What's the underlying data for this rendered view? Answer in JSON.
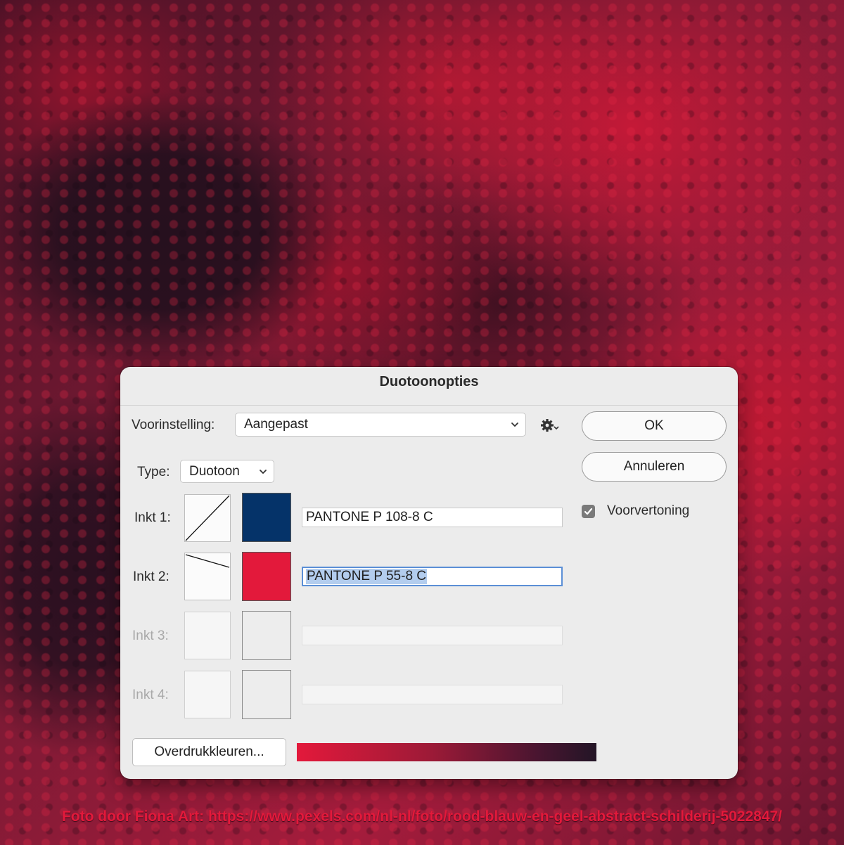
{
  "background": {
    "credit": "Foto door Fiona Art: https://www.pexels.com/nl-nl/foto/rood-blauw-en-geel-abstract-schilderij-5022847/",
    "accent_color": "#e3193b"
  },
  "dialog": {
    "title": "Duotoonopties",
    "preset": {
      "label": "Voorinstelling:",
      "value": "Aangepast",
      "settings_icon": "gear-icon"
    },
    "type": {
      "label": "Type:",
      "value": "Duotoon"
    },
    "buttons": {
      "ok": "OK",
      "cancel": "Annuleren"
    },
    "preview": {
      "label": "Voorvertoning",
      "checked": true
    },
    "inks": [
      {
        "label": "Inkt 1:",
        "name": "PANTONE P 108-8 C",
        "color": "#053369",
        "enabled": true
      },
      {
        "label": "Inkt 2:",
        "name": "PANTONE P 55-8 C",
        "color": "#e3193b",
        "enabled": true,
        "selected": true
      },
      {
        "label": "Inkt 3:",
        "name": "",
        "color": "",
        "enabled": false
      },
      {
        "label": "Inkt 4:",
        "name": "",
        "color": "",
        "enabled": false
      }
    ],
    "overprint_button": "Overdrukkleuren...",
    "ramp_colors": [
      "#e3193b",
      "#231526"
    ]
  }
}
